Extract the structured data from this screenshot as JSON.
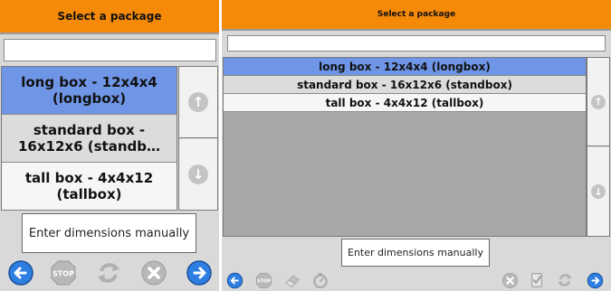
{
  "left": {
    "title": "Select a package",
    "search": {
      "value": "",
      "placeholder": ""
    },
    "packages": [
      {
        "label": "long box - 12x4x4 (longbox)",
        "selected": true
      },
      {
        "label": "standard box - 16x12x6 (standb…",
        "selected": false
      },
      {
        "label": "tall box - 4x4x12 (tallbox)",
        "selected": false
      }
    ],
    "manual_button": "Enter dimensions manually",
    "toolbar": [
      "back-icon",
      "stop-icon",
      "refresh-icon",
      "cancel-icon",
      "forward-icon"
    ]
  },
  "right": {
    "title": "Select a package",
    "search": {
      "value": "",
      "placeholder": ""
    },
    "packages": [
      {
        "label": "long box - 12x4x4 (longbox)",
        "selected": true
      },
      {
        "label": "standard box - 16x12x6 (standbox)",
        "selected": false
      },
      {
        "label": "tall box - 4x4x12 (tallbox)",
        "selected": false
      }
    ],
    "manual_button": "Enter dimensions manually",
    "toolbar": [
      "back-icon",
      "stop-icon",
      "eraser-icon",
      "timer-icon",
      "cancel-icon",
      "checklist-icon",
      "refresh-icon",
      "forward-icon"
    ]
  },
  "colors": {
    "accent": "#f58a08",
    "selected": "#6f96e6",
    "nav_blue": "#2f7fe3",
    "disabled_gray": "#b8b8b8"
  },
  "glyphs": {
    "scroll_up": "↑",
    "scroll_down": "↓"
  }
}
